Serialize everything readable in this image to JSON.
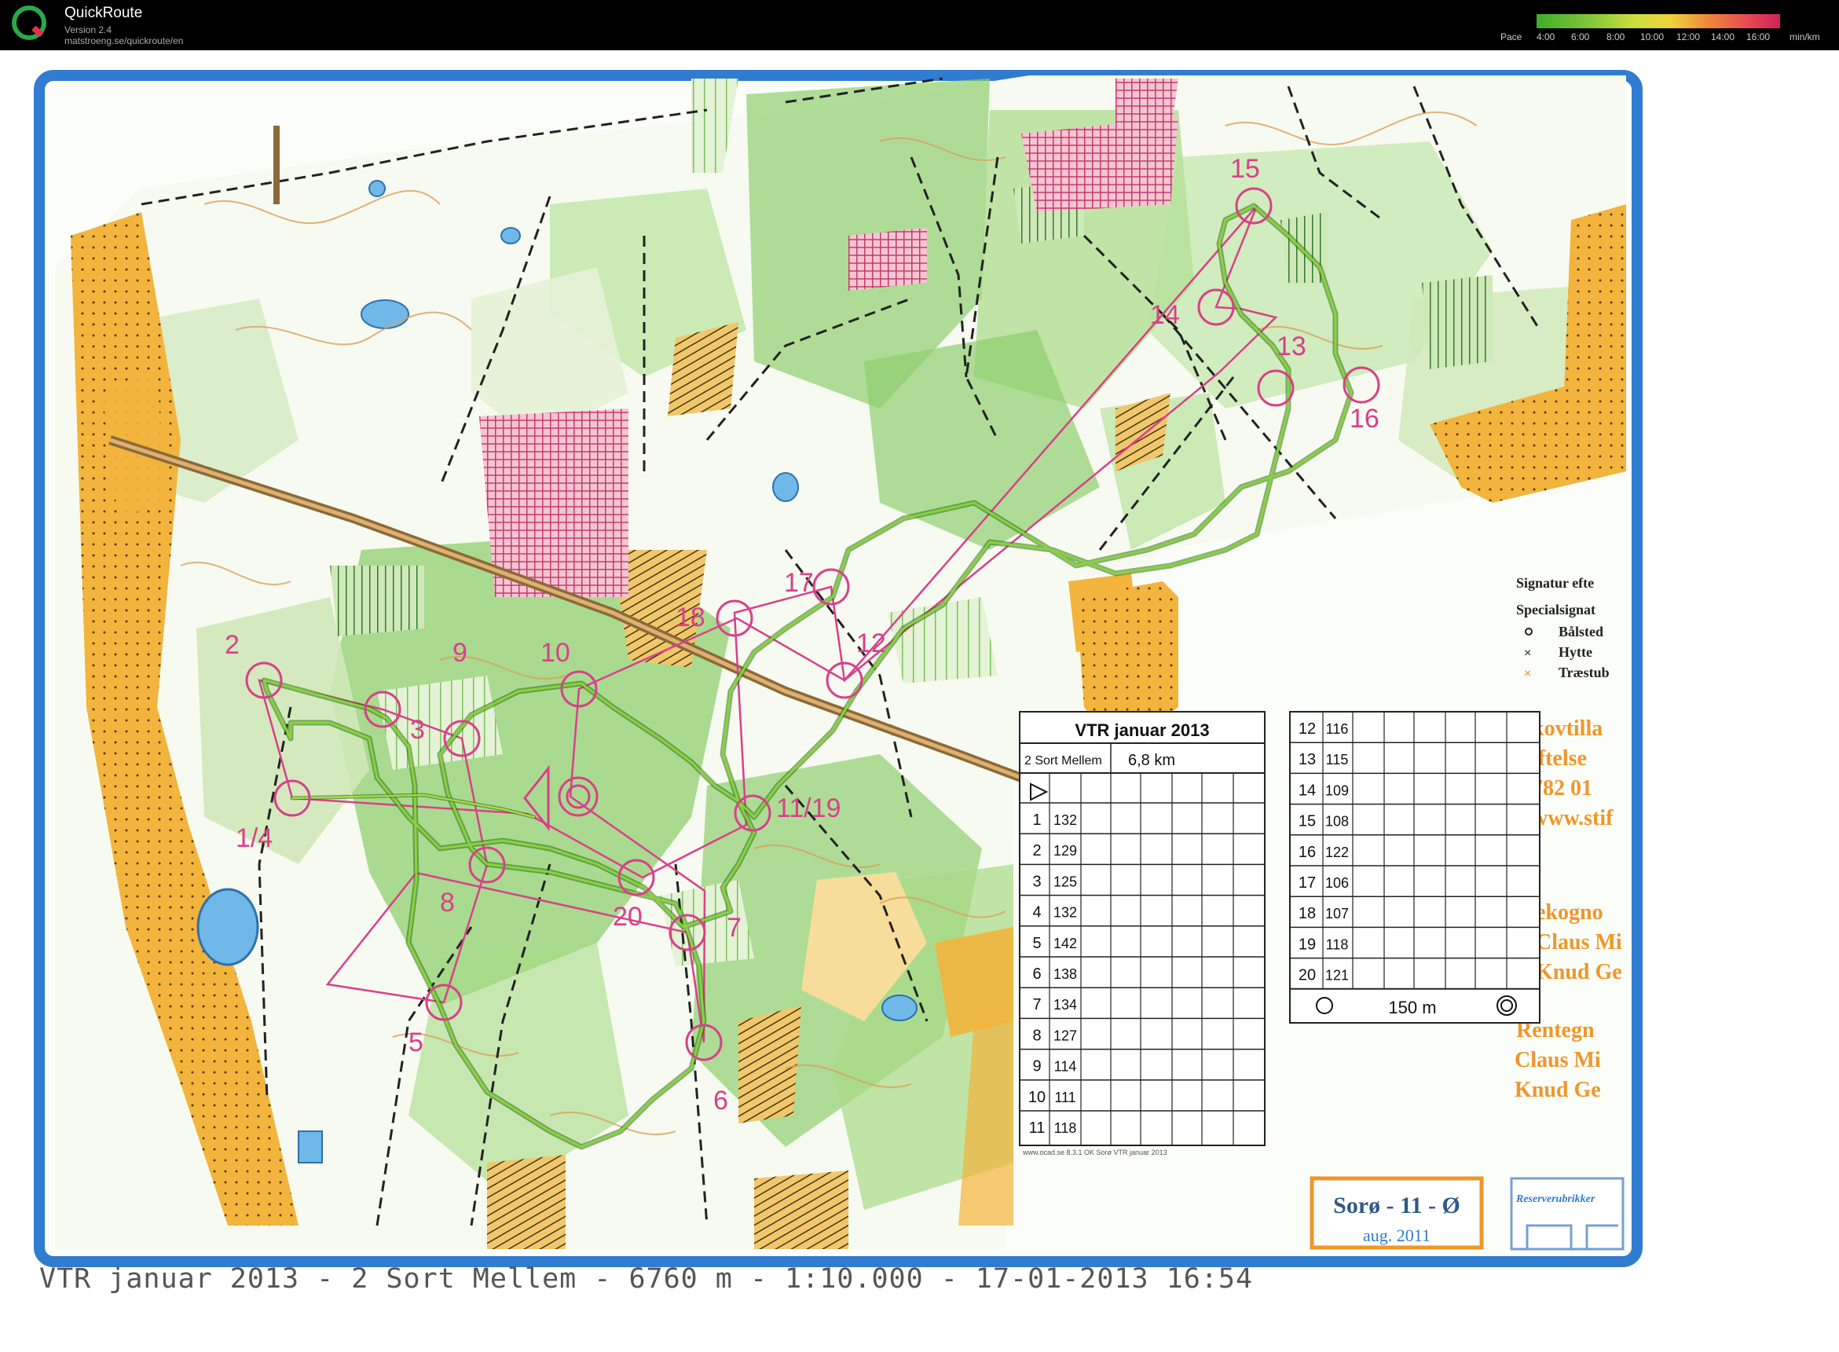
{
  "app": {
    "title": "QuickRoute",
    "version": "Version 2.4",
    "url": "matstroeng.se/quickroute/en"
  },
  "pace_legend": {
    "label": "Pace",
    "ticks": [
      "4:00",
      "6:00",
      "8:00",
      "10:00",
      "12:00",
      "14:00",
      "16:00"
    ],
    "unit": "min/km"
  },
  "control_table": {
    "title": "VTR januar 2013",
    "course": "2 Sort Mellem",
    "length": "6,8 km",
    "left_rows": [
      {
        "n": "1",
        "code": "132"
      },
      {
        "n": "2",
        "code": "129"
      },
      {
        "n": "3",
        "code": "125"
      },
      {
        "n": "4",
        "code": "132"
      },
      {
        "n": "5",
        "code": "142"
      },
      {
        "n": "6",
        "code": "138"
      },
      {
        "n": "7",
        "code": "134"
      },
      {
        "n": "8",
        "code": "127"
      },
      {
        "n": "9",
        "code": "114"
      },
      {
        "n": "10",
        "code": "111"
      },
      {
        "n": "11",
        "code": "118"
      }
    ],
    "right_rows": [
      {
        "n": "12",
        "code": "116"
      },
      {
        "n": "13",
        "code": "115"
      },
      {
        "n": "14",
        "code": "109"
      },
      {
        "n": "15",
        "code": "108"
      },
      {
        "n": "16",
        "code": "122"
      },
      {
        "n": "17",
        "code": "106"
      },
      {
        "n": "18",
        "code": "107"
      },
      {
        "n": "19",
        "code": "118"
      },
      {
        "n": "20",
        "code": "121"
      }
    ],
    "finish": "150 m",
    "footer": "www.ocad.se 8.3.1 OK Sorø VTR januar 2013"
  },
  "map_texts": {
    "legend_title": "Signatur efte",
    "legend_special": "Specialsignat",
    "legend_items": [
      "Bålsted",
      "Hytte",
      "Træstub"
    ],
    "orange_texts": [
      "kovtilla",
      "iftelse",
      "782 01",
      "www.stif",
      "ekogno",
      "Claus Mi",
      "Knud Ge",
      "Rentegn",
      "Claus Mi",
      "Knud Ge"
    ],
    "map_name": "Sorø - 11 - Ø",
    "map_date": "aug. 2011",
    "reserve_label": "Reserverubrikker"
  },
  "controls": [
    "1/4",
    "2",
    "3",
    "5",
    "6",
    "7",
    "8",
    "9",
    "10",
    "11/19",
    "12",
    "13",
    "14",
    "15",
    "16",
    "17",
    "18",
    "20"
  ],
  "caption": "VTR januar 2013 - 2 Sort Mellem - 6760 m - 1:10.000 - 17-01-2013 16:54"
}
